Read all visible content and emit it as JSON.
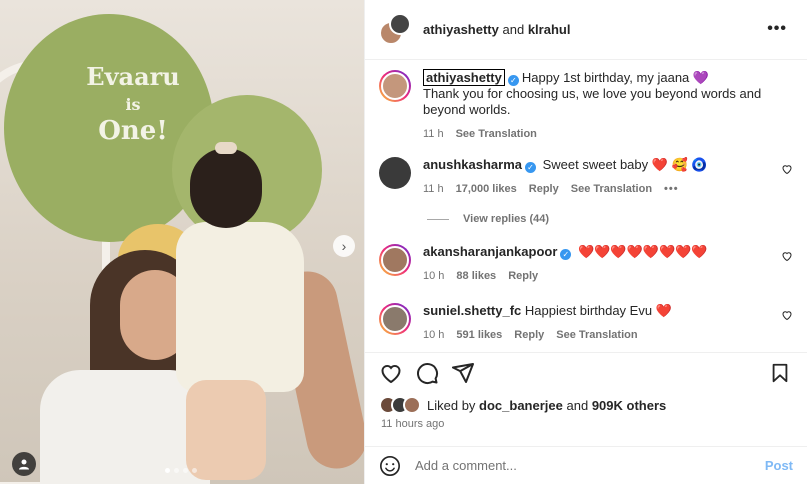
{
  "photo": {
    "balloon_text_line1": "Evaaru",
    "balloon_text_line2": "is",
    "balloon_text_line3": "One!",
    "carousel_total": 4,
    "carousel_active": 1
  },
  "header": {
    "user1": "athiyashetty",
    "and": "and",
    "user2": "klrahul"
  },
  "caption": {
    "username": "athiyashetty",
    "line1": "Happy 1st birthday, my jaana 💜",
    "line2": "Thank you for choosing us, we love you beyond words and beyond worlds.",
    "time": "11 h",
    "see_translation": "See Translation"
  },
  "comments": [
    {
      "username": "anushkasharma",
      "text": "Sweet sweet baby ❤️ 🥰 🧿",
      "time": "11 h",
      "likes": "17,000 likes",
      "reply": "Reply",
      "see_translation": "See Translation",
      "more": "•••"
    },
    {
      "username": "akansharanjankapoor",
      "text": "❤️❤️❤️❤️❤️❤️❤️❤️",
      "time": "10 h",
      "likes": "88 likes",
      "reply": "Reply"
    },
    {
      "username": "suniel.shetty_fc",
      "text": "Happiest birthday Evu ❤️",
      "time": "10 h",
      "likes": "591 likes",
      "reply": "Reply",
      "see_translation": "See Translation"
    }
  ],
  "view_replies": "View replies (44)",
  "likes": {
    "prefix": "Liked by",
    "user": "doc_banerjee",
    "and": "and",
    "count": "909K others"
  },
  "posted_time": "11 hours ago",
  "add_comment": {
    "placeholder": "Add a comment...",
    "post_label": "Post"
  },
  "colors": {
    "verified": "#3797f0",
    "post_disabled": "#7fb9f5",
    "balloon": "#9aae62"
  }
}
